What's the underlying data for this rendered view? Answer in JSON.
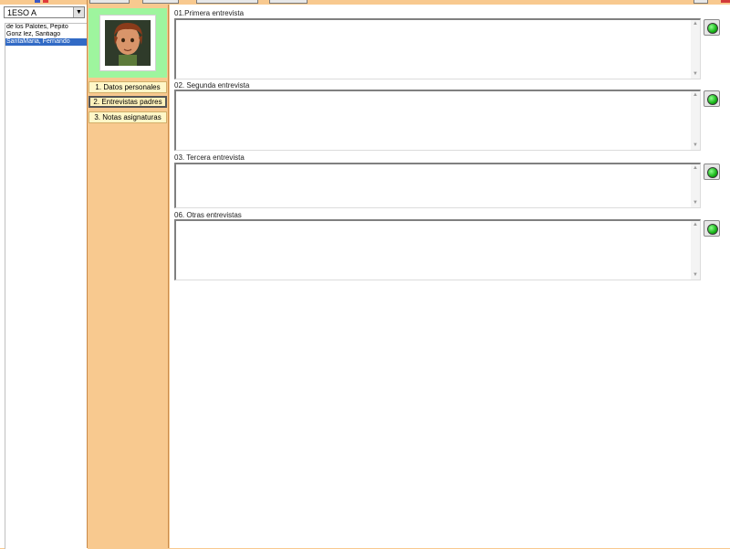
{
  "toolbar": {
    "buttons": [
      "toolbar-button-1",
      "toolbar-button-2",
      "toolbar-button-3",
      "toolbar-button-4"
    ]
  },
  "sidebar": {
    "group_select_value": "1ESO A",
    "students": [
      {
        "name": "de los Palotes, Pepito"
      },
      {
        "name": "Gonz lez, Santiago"
      },
      {
        "name": "SantaMaria, Fernando"
      }
    ]
  },
  "nav": {
    "items": [
      {
        "label": "1. Datos personales"
      },
      {
        "label": "2. Entrevistas padres"
      },
      {
        "label": "3. Notas asignaturas"
      }
    ],
    "active_index": 1
  },
  "interviews": [
    {
      "label": "01.Primera entrevista",
      "value": ""
    },
    {
      "label": "02. Segunda entrevista",
      "value": ""
    },
    {
      "label": "03. Tercera entrevista",
      "value": ""
    },
    {
      "label": "06. Otras entrevistas",
      "value": ""
    }
  ],
  "colors": {
    "background": "#f8c98f",
    "photo_frame": "#9ef59e",
    "selected_row": "#316ac5",
    "status_led": "#16b516"
  },
  "icons": {
    "student_photo": "avatar-cartoon-boy",
    "status": "green-led-icon"
  }
}
